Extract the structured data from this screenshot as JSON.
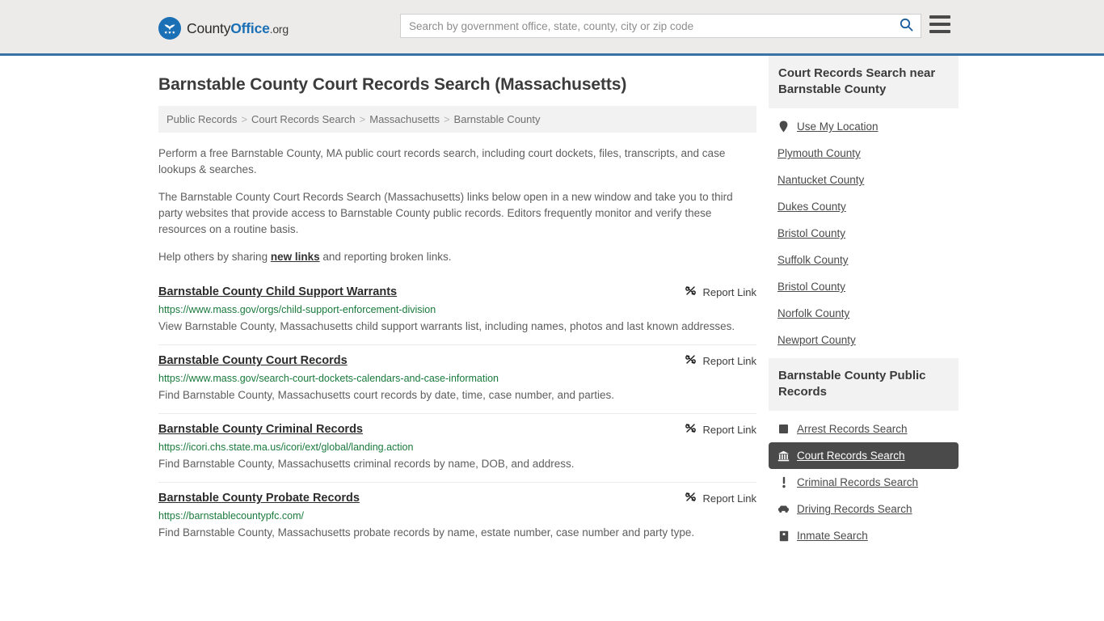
{
  "header": {
    "logo": {
      "part1": "County",
      "part2": "Office",
      "part3": ".org"
    },
    "search": {
      "placeholder": "Search by government office, state, county, city or zip code",
      "value": ""
    },
    "accent_color": "#3a72a6",
    "background_color": "#ecebe9"
  },
  "page": {
    "title": "Barnstable County Court Records Search (Massachusetts)"
  },
  "breadcrumb": {
    "items": [
      {
        "label": "Public Records"
      },
      {
        "label": "Court Records Search"
      },
      {
        "label": "Massachusetts"
      },
      {
        "label": "Barnstable County"
      }
    ],
    "separator": ">"
  },
  "intro": {
    "p1": "Perform a free Barnstable County, MA public court records search, including court dockets, files, transcripts, and case lookups & searches.",
    "p2": "The Barnstable County Court Records Search (Massachusetts) links below open in a new window and take you to third party websites that provide access to Barnstable County public records. Editors frequently monitor and verify these resources on a routine basis.",
    "p3_before": "Help others by sharing ",
    "p3_link": "new links",
    "p3_after": " and reporting broken links."
  },
  "results": {
    "report_label": "Report Link",
    "items": [
      {
        "title": "Barnstable County Child Support Warrants",
        "url": "https://www.mass.gov/orgs/child-support-enforcement-division",
        "description": "View Barnstable County, Massachusetts child support warrants list, including names, photos and last known addresses."
      },
      {
        "title": "Barnstable County Court Records",
        "url": "https://www.mass.gov/search-court-dockets-calendars-and-case-information",
        "description": "Find Barnstable County, Massachusetts court records by date, time, case number, and parties."
      },
      {
        "title": "Barnstable County Criminal Records",
        "url": "https://icori.chs.state.ma.us/icori/ext/global/landing.action",
        "description": "Find Barnstable County, Massachusetts criminal records by name, DOB, and address."
      },
      {
        "title": "Barnstable County Probate Records",
        "url": "https://barnstablecountypfc.com/",
        "description": "Find Barnstable County, Massachusetts probate records by name, estate number, case number and party type."
      }
    ]
  },
  "sidebar": {
    "nearby": {
      "heading": "Court Records Search near Barnstable County",
      "use_my_location": "Use My Location",
      "counties": [
        "Plymouth County",
        "Nantucket County",
        "Dukes County",
        "Bristol County",
        "Suffolk County",
        "Bristol County",
        "Norfolk County",
        "Newport County"
      ]
    },
    "public_records": {
      "heading": "Barnstable County Public Records",
      "items": [
        {
          "label": "Arrest Records Search",
          "icon": "square-icon",
          "active": false
        },
        {
          "label": "Court Records Search",
          "icon": "courthouse-icon",
          "active": true
        },
        {
          "label": "Criminal Records Search",
          "icon": "exclamation-icon",
          "active": false
        },
        {
          "label": "Driving Records Search",
          "icon": "car-icon",
          "active": false
        },
        {
          "label": "Inmate Search",
          "icon": "inmate-icon",
          "active": false
        }
      ]
    }
  }
}
